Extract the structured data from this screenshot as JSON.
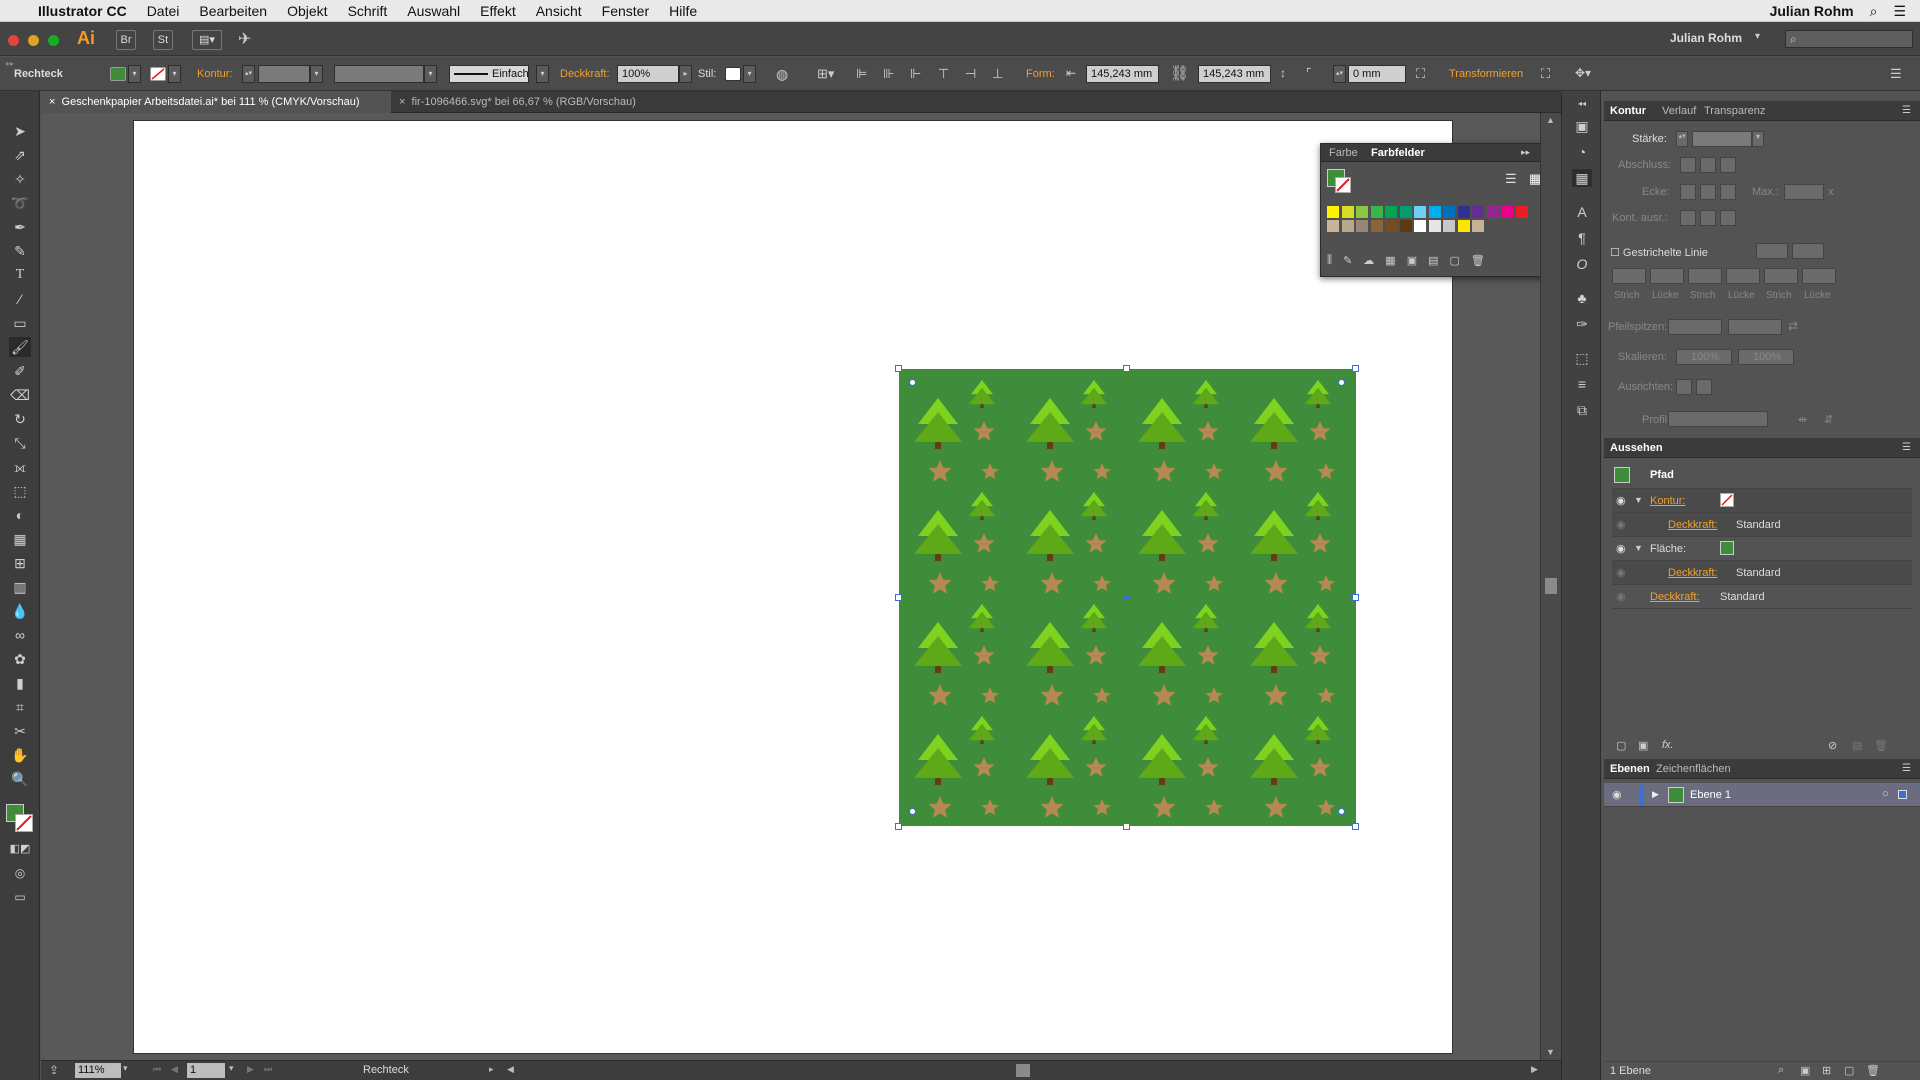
{
  "menubar": {
    "app_name": "Illustrator CC",
    "items": [
      "Datei",
      "Bearbeiten",
      "Objekt",
      "Schrift",
      "Auswahl",
      "Effekt",
      "Ansicht",
      "Fenster",
      "Hilfe"
    ],
    "user": "Julian Rohm"
  },
  "appbar": {
    "ai_logo": "Ai",
    "br": "Br",
    "st": "St",
    "workspace_user": "Julian Rohm",
    "search_placeholder": ""
  },
  "control": {
    "object_type": "Rechteck",
    "kontur_label": "Kontur:",
    "stroke_style": "Einfach",
    "deckkraft_label": "Deckkraft:",
    "deckkraft_value": "100%",
    "stil_label": "Stil:",
    "form_label": "Form:",
    "width_value": "145,243 mm",
    "height_value": "145,243 mm",
    "corner_value": "0 mm",
    "transform_label": "Transformieren"
  },
  "tabs": [
    {
      "label": "Geschenkpapier Arbeitsdatei.ai* bei 111 % (CMYK/Vorschau)",
      "active": true
    },
    {
      "label": "fir-1096466.svg* bei 66,67 % (RGB/Vorschau)",
      "active": false
    }
  ],
  "status": {
    "zoom": "111%",
    "artboard_number": "1",
    "tool_name": "Rechteck"
  },
  "swatch_panel": {
    "tab_farbe": "Farbe",
    "tab_farbfelder": "Farbfelder",
    "colors": [
      "#fff200",
      "#d7df23",
      "#8dc63f",
      "#39b54a",
      "#00a651",
      "#009e6f",
      "#6dcff6",
      "#00aeef",
      "#0072bc",
      "#2e3192",
      "#662d91",
      "#92278f",
      "#ec008c",
      "#ed1c24",
      "#c8b49a",
      "#b7a98b",
      "#998675",
      "#8c6239",
      "#754c24",
      "#603913",
      "#ffffff",
      "#e6e6e6",
      "#c8c8c8",
      "#ffe600",
      "#c7b299"
    ]
  },
  "kontur_panel": {
    "tab_kontur": "Kontur",
    "tab_verlauf": "Verlauf",
    "tab_transparenz": "Transparenz",
    "staerke": "Stärke:",
    "abschluss": "Abschluss:",
    "ecke": "Ecke:",
    "max": "Max.:",
    "max_x": "x",
    "kont_ausr": "Kont. ausr.:",
    "gestrichelte": "Gestrichelte Linie",
    "dash_labels": [
      "Strich",
      "Lücke",
      "Strich",
      "Lücke",
      "Strich",
      "Lücke"
    ],
    "pfeilspitzen": "Pfeilspitzen:",
    "skalieren": "Skalieren:",
    "skal_a": "100%",
    "skal_b": "100%",
    "ausrichten": "Ausrichten:",
    "profil": "Profil:"
  },
  "aussehen_panel": {
    "title": "Aussehen",
    "path_label": "Pfad",
    "kontur": "Kontur:",
    "deckkraft": "Deckkraft:",
    "standard": "Standard",
    "flaeche": "Fläche:"
  },
  "ebenen_panel": {
    "tab_ebenen": "Ebenen",
    "tab_zeichenflaechen": "Zeichenflächen",
    "layer_name": "Ebene 1",
    "layer_count": "1 Ebene"
  },
  "colors": {
    "pattern_bg": "#3f8d3a",
    "tree": "#7ed321",
    "tree_dark": "#5fa818",
    "trunk": "#6b3a10",
    "star": "#b48a4e",
    "selection": "#3b6fd6",
    "accent_orange": "#f2a02c"
  }
}
